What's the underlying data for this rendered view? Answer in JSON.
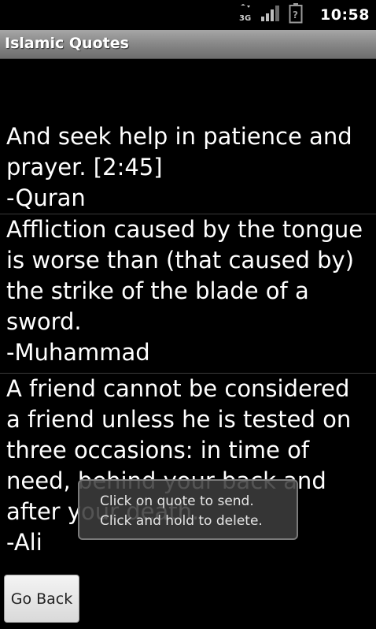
{
  "status_bar": {
    "network_type": "3G",
    "time": "10:58",
    "icons": [
      "network-3g-icon",
      "signal-strength-icon",
      "battery-unknown-icon"
    ]
  },
  "app": {
    "title": "Islamic Quotes"
  },
  "quotes": [
    {
      "text": "And seek help in patience and prayer. [2:45]",
      "author": "-Quran"
    },
    {
      "text": "Affliction caused by the tongue is worse than (that caused by) the strike of the blade of a sword.",
      "author": "-Muhammad"
    },
    {
      "text": "A friend cannot be considered a friend unless he is tested on three occasions: in time of need, behind your back and after your death.",
      "author": "-Ali"
    }
  ],
  "toast": {
    "line1": "Click on quote to send.",
    "line2": "Click and hold to delete."
  },
  "buttons": {
    "go_back_label": "Go Back"
  },
  "colors": {
    "background": "#000000",
    "text": "#ffffff",
    "title_bar": "#8a8a8a",
    "divider": "#3a3a3a"
  }
}
